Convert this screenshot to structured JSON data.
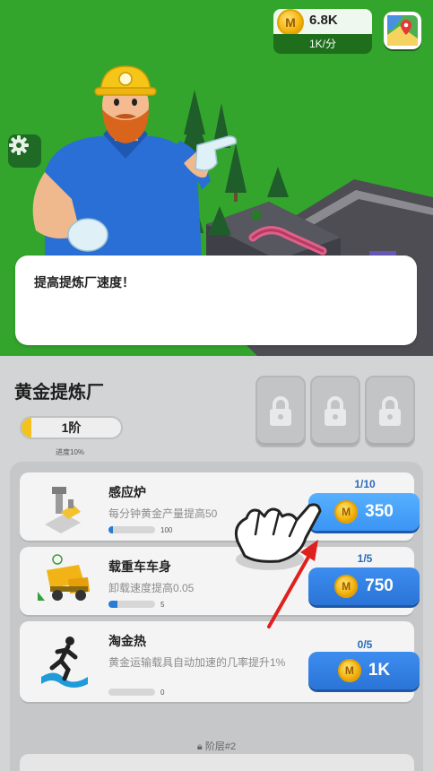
{
  "hud": {
    "coin_symbol": "M",
    "coin_amount": "6.8K",
    "rate": "1K/分",
    "map_icon": "map-icon",
    "settings_icon": "gear-icon"
  },
  "tutorial": {
    "character": "miner-foreman",
    "message": "提高提炼厂速度！"
  },
  "panel": {
    "title": "黄金提炼厂",
    "tier_label": "1阶",
    "tier_progress": 0.1,
    "progress_caption": "进度10%",
    "locked_slots": 3,
    "floor_label": "阶层#2",
    "upgrades": [
      {
        "name": "感应炉",
        "description": "每分钟黄金产量提高50",
        "level": "1/10",
        "bar_value": "100",
        "bar_fill": 0.1,
        "price": "350",
        "highlighted": true
      },
      {
        "name": "载重车车身",
        "description": "卸载速度提高0.05",
        "level": "1/5",
        "bar_value": "5",
        "bar_fill": 0.2,
        "price": "750",
        "highlighted": false
      },
      {
        "name": "淘金热",
        "description": "黄金运输载具自动加速的几率提升1%",
        "level": "0/5",
        "bar_value": "0",
        "bar_fill": 0,
        "price": "1K",
        "highlighted": false
      }
    ]
  },
  "colors": {
    "grass": "#33a52c",
    "button_blue": "#2a74d6",
    "coin_gold": "#f2b20c",
    "pointer_red": "#e0201e"
  }
}
